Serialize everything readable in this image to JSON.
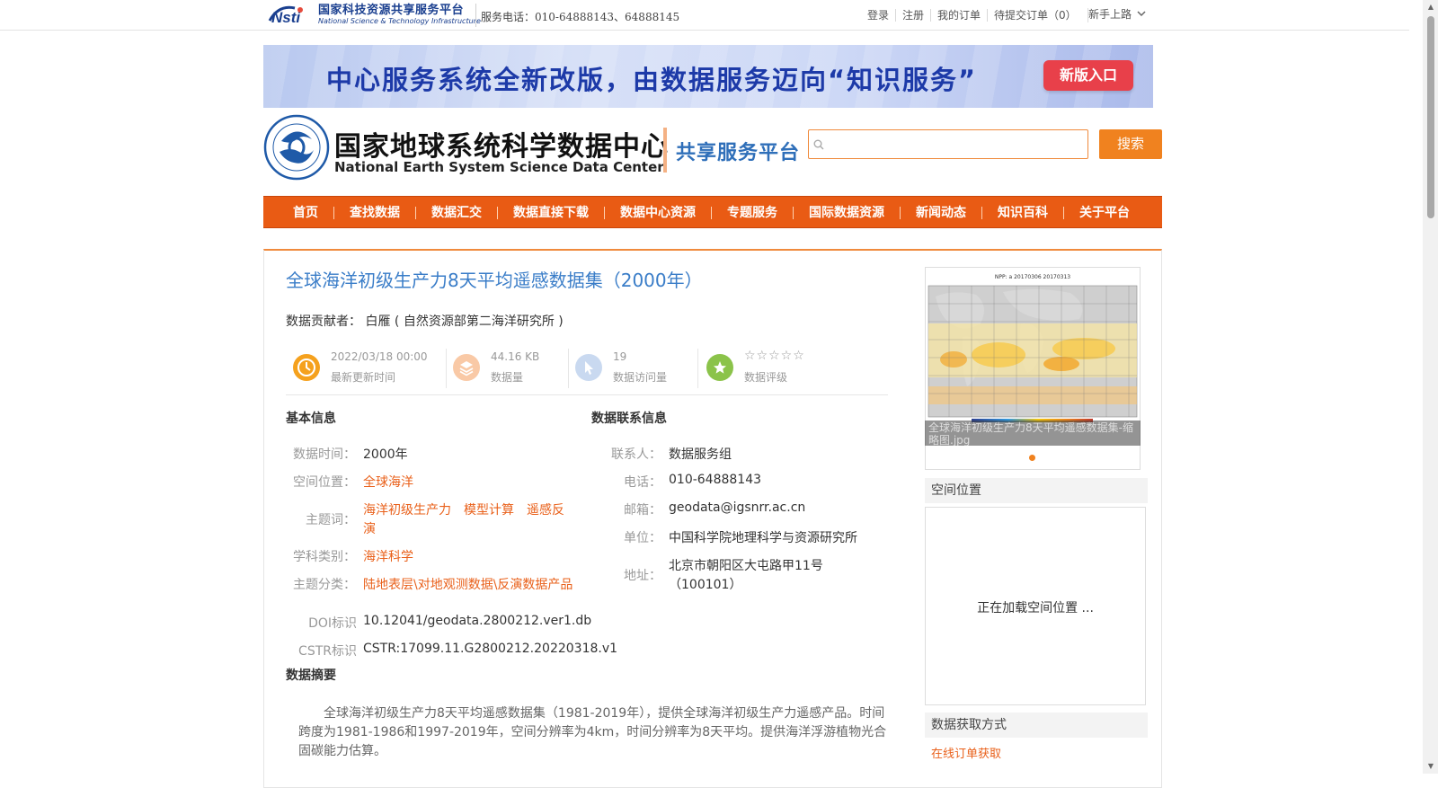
{
  "topbar": {
    "logo_cn": "国家科技资源共享服务平台",
    "logo_en": "National Science & Technology Infrastructure",
    "service_phone": "服务电话：010-64888143、64888145",
    "links": [
      "登录",
      "注册",
      "我的订单",
      "待提交订单（0）"
    ],
    "guide": "新手上路"
  },
  "banner": {
    "text": "中心服务系统全新改版，由数据服务迈向“知识服务”",
    "button": "新版入口"
  },
  "header": {
    "center_cn": "国家地球系统科学数据中心",
    "center_en": "National Earth System Science Data Center",
    "platform": "共享服务平台",
    "search_placeholder": "",
    "search_button": "搜索"
  },
  "nav": [
    "首页",
    "查找数据",
    "数据汇交",
    "数据直接下载",
    "数据中心资源",
    "专题服务",
    "国际数据资源",
    "新闻动态",
    "知识百科",
    "关于平台"
  ],
  "dataset": {
    "title": "全球海洋初级生产力8天平均遥感数据集（2000年）",
    "contributor_label": "数据贡献者：",
    "contributor": "白雁 ( 自然资源部第二海洋研究所 )",
    "stats": {
      "update_time": "2022/03/18 00:00",
      "update_label": "最新更新时间",
      "size": "44.16 KB",
      "size_label": "数据量",
      "visits": "19",
      "visits_label": "数据访问量",
      "stars": "☆☆☆☆☆",
      "rating_label": "数据评级"
    }
  },
  "basic_info": {
    "title": "基本信息",
    "time_label": "数据时间：",
    "time": "2000年",
    "space_label": "空间位置：",
    "space": "全球海洋",
    "keyword_label": "主题词：",
    "keywords": "海洋初级生产力　模型计算　遥感反",
    "keywords_cont": "演",
    "subject_label": "学科类别：",
    "subject": "海洋科学",
    "category_label": "主题分类：",
    "category": "陆地表层\\对地观测数据\\反演数据产品",
    "doi_label": "DOI标识",
    "doi": "10.12041/geodata.2800212.ver1.db",
    "cstr_label": "CSTR标识",
    "cstr": "CSTR:17099.11.G2800212.20220318.v1"
  },
  "contact": {
    "title": "数据联系信息",
    "person_label": "联系人：",
    "person": "数据服务组",
    "phone_label": "电话：",
    "phone": "010-64888143",
    "email_label": "邮箱：",
    "email": "geodata@igsnrr.ac.cn",
    "unit_label": "单位：",
    "unit": "中国科学院地理科学与资源研究所",
    "address_label": "地址：",
    "address": "北京市朝阳区大屯路甲11号",
    "address_cont": "（100101）"
  },
  "abstract": {
    "title": "数据摘要",
    "text": "全球海洋初级生产力8天平均遥感数据集（1981-2019年），提供全球海洋初级生产力遥感产品。时间跨度为1981-1986和1997-2019年，空间分辨率为4km，时间分辨率为8天平均。提供海洋浮游植物光合固碳能力估算。"
  },
  "sidebar": {
    "thumb_title": "NPP: a 20170306 20170313",
    "thumb_caption": "全球海洋初级生产力8天平均遥感数据集-缩略图.jpg",
    "space_title": "空间位置",
    "space_loading": "正在加载空间位置 ...",
    "access_title": "数据获取方式",
    "access_link": "在线订单获取"
  },
  "colors": {
    "accent": "#e95b14",
    "link_blue": "#3a7dc8",
    "orange_text": "#e9601a"
  }
}
